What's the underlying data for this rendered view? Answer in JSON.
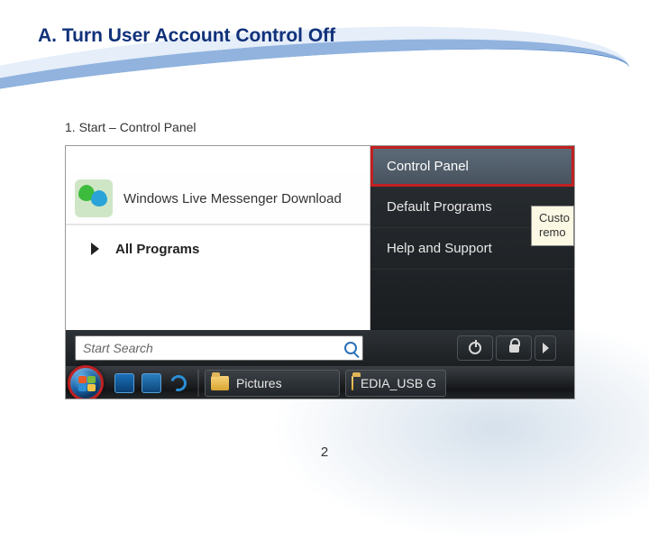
{
  "slide": {
    "title": "A. Turn User Account Control Off",
    "step1": "1. Start – Control Panel",
    "page_number": "2"
  },
  "start_menu": {
    "left": {
      "messenger_label": "Windows Live Messenger Download",
      "all_programs_label": "All Programs"
    },
    "right": {
      "control_panel": "Control Panel",
      "default_programs": "Default Programs",
      "help_support": "Help and Support"
    },
    "tooltip": {
      "line1": "Custo",
      "line2": "remo"
    },
    "search": {
      "placeholder": "Start Search"
    }
  },
  "taskbar": {
    "task1_label": "Pictures",
    "task2_label": "EDIA_USB G"
  }
}
